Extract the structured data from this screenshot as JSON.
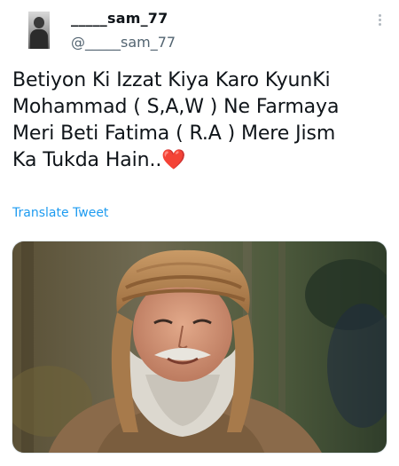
{
  "user": {
    "display_name": "_____sam_77",
    "handle": "@_____sam_77"
  },
  "tweet": {
    "lines": [
      "Betiyon Ki Izzat Kiya Karo KyunKi",
      "Mohammad ( S,A,W ) Ne Farmaya",
      "Meri Beti Fatima ( R.A ) Mere Jism",
      "Ka Tukda Hain.."
    ],
    "emoji": "❤️",
    "translate_label": "Translate Tweet"
  },
  "icons": {
    "more": "more-vertical-icon",
    "avatar": "avatar"
  },
  "colors": {
    "text": "#0f1419",
    "secondary_text": "#536471",
    "link": "#1d9bf0",
    "heart": "#e0245e"
  }
}
